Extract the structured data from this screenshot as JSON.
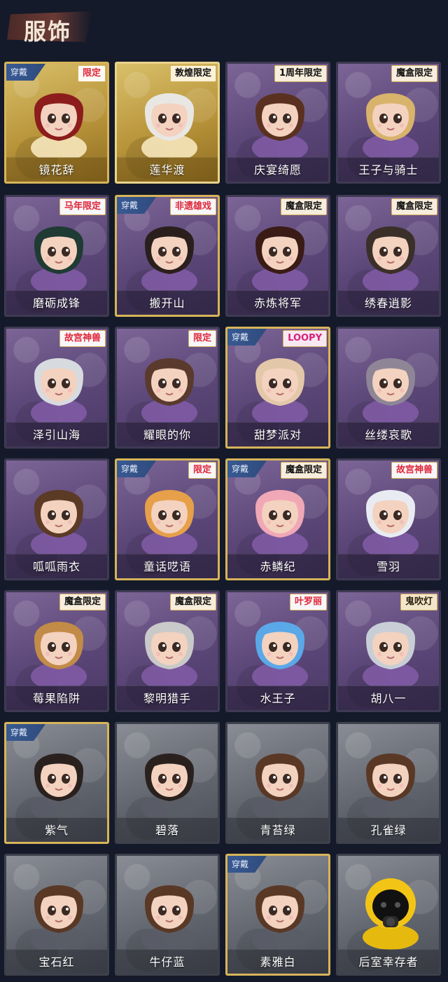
{
  "header": {
    "title": "服饰"
  },
  "colors": {
    "background": "#141a29",
    "purple_card": "#5b4678",
    "gold_card": "#b8943a",
    "gray_card": "#5f636c",
    "worn_tag": "#385a93",
    "worn_border": "#d7b45a"
  },
  "cards": [
    {
      "name": "镜花辞",
      "style": "gold",
      "worn": true,
      "worn_label": "穿戴",
      "badge": "限定",
      "badge_style": "red",
      "icon": "red-hood-girl-icon"
    },
    {
      "name": "莲华渡",
      "style": "gold",
      "worn": false,
      "worn_label": "",
      "badge": "敦煌限定",
      "badge_style": "black",
      "icon": "white-hair-boy-icon"
    },
    {
      "name": "庆宴绮愿",
      "style": "purple",
      "worn": false,
      "worn_label": "",
      "badge": "1周年限定",
      "badge_style": "black",
      "icon": "cake-boy-icon"
    },
    {
      "name": "王子与骑士",
      "style": "purple",
      "worn": false,
      "worn_label": "",
      "badge": "魔盒限定",
      "badge_style": "black",
      "icon": "captain-hat-boy-icon"
    },
    {
      "name": "磨砺成锋",
      "style": "purple",
      "worn": false,
      "worn_label": "",
      "badge": "马年限定",
      "badge_style": "red",
      "icon": "green-hair-boy-icon"
    },
    {
      "name": "搬开山",
      "style": "purple",
      "worn": true,
      "worn_label": "穿戴",
      "badge": "非遗雄戏",
      "badge_style": "red",
      "icon": "dark-hair-boy-icon"
    },
    {
      "name": "赤炼将军",
      "style": "purple",
      "worn": false,
      "worn_label": "",
      "badge": "魔盒限定",
      "badge_style": "black",
      "icon": "masked-general-icon"
    },
    {
      "name": "绣春逍影",
      "style": "purple",
      "worn": false,
      "worn_label": "",
      "badge": "魔盒限定",
      "badge_style": "black",
      "icon": "headband-boy-icon"
    },
    {
      "name": "泽引山海",
      "style": "purple",
      "worn": false,
      "worn_label": "",
      "badge": "故宫神兽",
      "badge_style": "red",
      "icon": "silver-hair-boy-icon"
    },
    {
      "name": "耀眼的你",
      "style": "purple",
      "worn": false,
      "worn_label": "",
      "badge": "限定",
      "badge_style": "red",
      "icon": "cowboy-hat-girl-icon"
    },
    {
      "name": "甜梦派对",
      "style": "purple",
      "worn": true,
      "worn_label": "穿戴",
      "badge": "LOOPY",
      "badge_style": "loopy",
      "icon": "party-girl-icon"
    },
    {
      "name": "丝缕哀歌",
      "style": "purple",
      "worn": false,
      "worn_label": "",
      "badge": "",
      "badge_style": "black",
      "icon": "gothic-girl-icon"
    },
    {
      "name": "呱呱雨衣",
      "style": "purple",
      "worn": false,
      "worn_label": "",
      "badge": "",
      "badge_style": "black",
      "icon": "frog-hat-girl-icon"
    },
    {
      "name": "童话呓语",
      "style": "purple",
      "worn": true,
      "worn_label": "穿戴",
      "badge": "限定",
      "badge_style": "red",
      "icon": "fairytale-girl-icon"
    },
    {
      "name": "赤鳞纪",
      "style": "purple",
      "worn": true,
      "worn_label": "穿戴",
      "badge": "魔盒限定",
      "badge_style": "black",
      "icon": "pink-hair-girl-icon"
    },
    {
      "name": "雪羽",
      "style": "purple",
      "worn": false,
      "worn_label": "",
      "badge": "故宫神兽",
      "badge_style": "red",
      "icon": "white-hair-girl-icon"
    },
    {
      "name": "莓果陷阱",
      "style": "purple",
      "worn": false,
      "worn_label": "",
      "badge": "魔盒限定",
      "badge_style": "black",
      "icon": "berry-hat-girl-icon"
    },
    {
      "name": "黎明猎手",
      "style": "purple",
      "worn": false,
      "worn_label": "",
      "badge": "魔盒限定",
      "badge_style": "black",
      "icon": "hunter-boy-icon"
    },
    {
      "name": "水王子",
      "style": "purple",
      "worn": false,
      "worn_label": "",
      "badge": "叶罗丽",
      "badge_style": "red",
      "icon": "blue-hair-prince-icon"
    },
    {
      "name": "胡八一",
      "style": "purple",
      "worn": false,
      "worn_label": "",
      "badge": "鬼吹灯",
      "badge_style": "ghost",
      "icon": "goggles-boy-icon"
    },
    {
      "name": "紫气",
      "style": "gray",
      "worn": true,
      "worn_label": "穿戴",
      "badge": "",
      "badge_style": "black",
      "icon": "braid-boy-icon"
    },
    {
      "name": "碧落",
      "style": "gray",
      "worn": false,
      "worn_label": "",
      "badge": "",
      "badge_style": "black",
      "icon": "braid-boy-icon"
    },
    {
      "name": "青苔绿",
      "style": "gray",
      "worn": false,
      "worn_label": "",
      "badge": "",
      "badge_style": "black",
      "icon": "brown-hair-girl-icon"
    },
    {
      "name": "孔雀绿",
      "style": "gray",
      "worn": false,
      "worn_label": "",
      "badge": "",
      "badge_style": "black",
      "icon": "brown-hair-girl-icon"
    },
    {
      "name": "宝石红",
      "style": "gray",
      "worn": false,
      "worn_label": "",
      "badge": "",
      "badge_style": "black",
      "icon": "brown-hair-girl-icon"
    },
    {
      "name": "牛仔蓝",
      "style": "gray",
      "worn": false,
      "worn_label": "",
      "badge": "",
      "badge_style": "black",
      "icon": "brown-hair-girl-icon"
    },
    {
      "name": "素雅白",
      "style": "gray",
      "worn": true,
      "worn_label": "穿戴",
      "badge": "",
      "badge_style": "black",
      "icon": "brown-hair-girl-icon"
    },
    {
      "name": "后室幸存者",
      "style": "gray",
      "worn": false,
      "worn_label": "",
      "badge": "",
      "badge_style": "black",
      "icon": "hazmat-survivor-icon"
    }
  ]
}
